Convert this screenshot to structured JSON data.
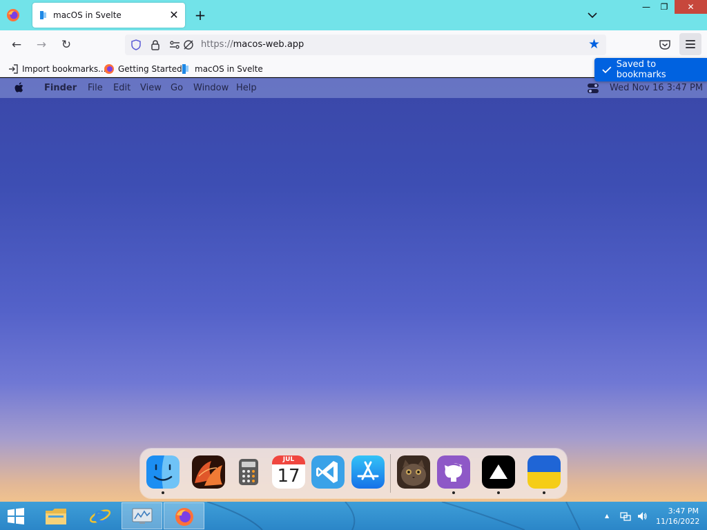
{
  "browser": {
    "tab": {
      "title": "macOS in Svelte",
      "close_glyph": "✕",
      "icon": "svelte-doc-icon"
    },
    "new_tab_glyph": "+",
    "window_controls": {
      "minimize": "—",
      "restore": "❐",
      "close": "✕"
    },
    "nav": {
      "back": "←",
      "forward": "→",
      "reload": "↻"
    },
    "url": {
      "scheme": "https://",
      "host": "macos-web.app"
    },
    "bookmark_star": "★",
    "bookmarks": [
      {
        "label": "Import bookmarks...",
        "icon": "import-icon"
      },
      {
        "label": "Getting Started",
        "icon": "firefox-icon"
      },
      {
        "label": "macOS in Svelte",
        "icon": "svelte-doc-icon"
      }
    ],
    "toast": {
      "text": "Saved to bookmarks"
    }
  },
  "macos": {
    "menubar": {
      "app": "Finder",
      "items": [
        "File",
        "Edit",
        "View",
        "Go",
        "Window",
        "Help"
      ],
      "datetime": "Wed Nov 16   3:47 PM"
    },
    "dock": {
      "apps": [
        {
          "name": "finder",
          "running": true
        },
        {
          "name": "wallpapers",
          "running": false
        },
        {
          "name": "calculator",
          "running": false
        },
        {
          "name": "calendar",
          "running": false,
          "month": "JUL",
          "day": "17"
        },
        {
          "name": "vscode",
          "running": false
        },
        {
          "name": "app-store",
          "running": false
        },
        {
          "name": "purus-twitter",
          "running": false
        },
        {
          "name": "github",
          "running": true
        },
        {
          "name": "vercel",
          "running": true
        },
        {
          "name": "ukraine",
          "running": true
        }
      ]
    }
  },
  "taskbar": {
    "clock_time": "3:47 PM",
    "clock_date": "11/16/2022",
    "tray_caret": "▲"
  }
}
